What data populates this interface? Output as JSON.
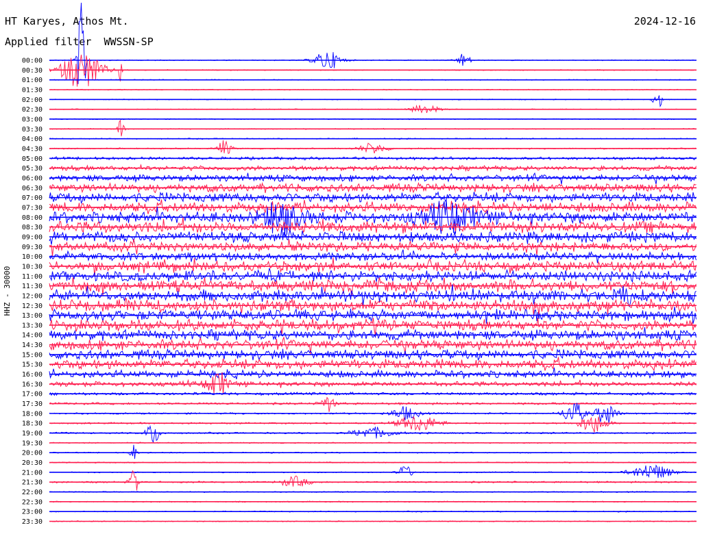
{
  "header": {
    "station": "HT Karyes, Athos Mt.",
    "date": "2024-12-16",
    "filter": "Applied filter  WWSSN-SP",
    "channel": "HHZ - 30000"
  },
  "colors": {
    "even_trace": "#0000ff",
    "odd_trace": "#ff1a4d",
    "text": "#000000"
  },
  "chart_data": {
    "type": "seismogram-helicorder",
    "title": "HT Karyes, Athos Mt.",
    "date": "2024-12-16",
    "filter": "WWSSN-SP",
    "ylabel": "HHZ - 30000",
    "rows": [
      "00:00",
      "00:30",
      "01:00",
      "01:30",
      "02:00",
      "02:30",
      "03:00",
      "03:30",
      "04:00",
      "04:30",
      "05:00",
      "05:30",
      "06:00",
      "06:30",
      "07:00",
      "07:30",
      "08:00",
      "08:30",
      "09:00",
      "09:30",
      "10:00",
      "10:30",
      "11:00",
      "11:30",
      "12:00",
      "12:30",
      "13:00",
      "13:30",
      "14:00",
      "14:30",
      "15:00",
      "15:30",
      "16:00",
      "16:30",
      "17:00",
      "17:30",
      "18:00",
      "18:30",
      "19:00",
      "19:30",
      "20:00",
      "20:30",
      "21:00",
      "21:30",
      "22:00",
      "22:30",
      "23:00",
      "23:30"
    ],
    "noise_level": [
      0.8,
      0.8,
      0.8,
      0.8,
      0.8,
      0.8,
      0.8,
      0.9,
      1.0,
      1.2,
      2.5,
      4.0,
      5.5,
      7.0,
      8.0,
      8.5,
      9.5,
      9.5,
      9.0,
      8.0,
      7.0,
      8.5,
      9.0,
      9.5,
      10.0,
      10.0,
      9.0,
      9.0,
      8.5,
      8.5,
      8.0,
      8.0,
      6.0,
      4.0,
      2.5,
      2.0,
      1.5,
      1.5,
      1.5,
      1.0,
      1.0,
      1.0,
      1.0,
      1.5,
      1.0,
      1.0,
      1.0,
      0.9
    ],
    "events": [
      {
        "row": 0,
        "x": 0.43,
        "amp": 14,
        "width": 0.02
      },
      {
        "row": 0,
        "x": 0.64,
        "amp": 10,
        "width": 0.01
      },
      {
        "row": 0,
        "x": 0.05,
        "amp": 90,
        "width": 0.006
      },
      {
        "row": 1,
        "x": 0.05,
        "amp": 28,
        "width": 0.03
      },
      {
        "row": 1,
        "x": 0.11,
        "amp": 30,
        "width": 0.002
      },
      {
        "row": 4,
        "x": 0.94,
        "amp": 16,
        "width": 0.006
      },
      {
        "row": 5,
        "x": 0.58,
        "amp": 7,
        "width": 0.02
      },
      {
        "row": 7,
        "x": 0.11,
        "amp": 12,
        "width": 0.005
      },
      {
        "row": 9,
        "x": 0.27,
        "amp": 12,
        "width": 0.01
      },
      {
        "row": 9,
        "x": 0.5,
        "amp": 8,
        "width": 0.02
      },
      {
        "row": 16,
        "x": 0.36,
        "amp": 20,
        "width": 0.03
      },
      {
        "row": 16,
        "x": 0.62,
        "amp": 18,
        "width": 0.04
      },
      {
        "row": 24,
        "x": 0.89,
        "amp": 14,
        "width": 0.01
      },
      {
        "row": 33,
        "x": 0.26,
        "amp": 18,
        "width": 0.015
      },
      {
        "row": 35,
        "x": 0.43,
        "amp": 12,
        "width": 0.01
      },
      {
        "row": 36,
        "x": 0.55,
        "amp": 10,
        "width": 0.02
      },
      {
        "row": 36,
        "x": 0.81,
        "amp": 18,
        "width": 0.015
      },
      {
        "row": 36,
        "x": 0.86,
        "amp": 16,
        "width": 0.015
      },
      {
        "row": 37,
        "x": 0.57,
        "amp": 12,
        "width": 0.03
      },
      {
        "row": 37,
        "x": 0.84,
        "amp": 14,
        "width": 0.02
      },
      {
        "row": 38,
        "x": 0.16,
        "amp": 16,
        "width": 0.01
      },
      {
        "row": 38,
        "x": 0.5,
        "amp": 8,
        "width": 0.03
      },
      {
        "row": 40,
        "x": 0.13,
        "amp": 12,
        "width": 0.005
      },
      {
        "row": 42,
        "x": 0.55,
        "amp": 10,
        "width": 0.01
      },
      {
        "row": 42,
        "x": 0.93,
        "amp": 12,
        "width": 0.03
      },
      {
        "row": 43,
        "x": 0.13,
        "amp": 24,
        "width": 0.006
      },
      {
        "row": 43,
        "x": 0.38,
        "amp": 8,
        "width": 0.02
      }
    ]
  }
}
